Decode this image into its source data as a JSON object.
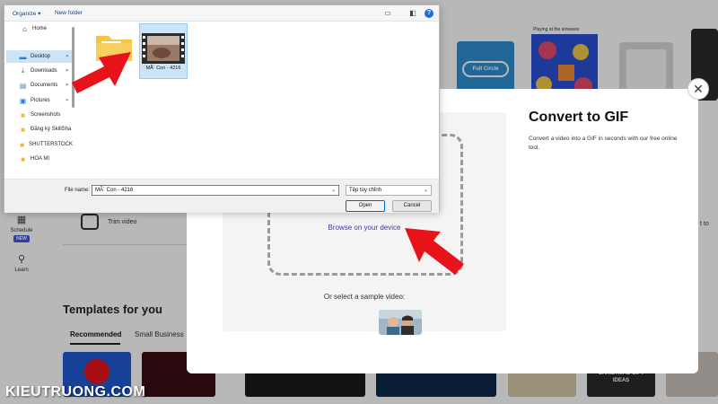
{
  "dialog": {
    "toolbar": {
      "organize_label": "Organize",
      "new_folder_label": "New folder"
    },
    "nav_items": [
      {
        "label": "Home",
        "icon": "home-icon"
      },
      {
        "label": "Desktop",
        "icon": "desktop-icon",
        "pinned": true,
        "selected": true
      },
      {
        "label": "Downloads",
        "icon": "download-icon",
        "pinned": true
      },
      {
        "label": "Documents",
        "icon": "document-icon",
        "pinned": true
      },
      {
        "label": "Pictures",
        "icon": "picture-icon",
        "pinned": true
      },
      {
        "label": "Screenshots",
        "icon": "folder-icon"
      },
      {
        "label": "Đăng ký SkillSha",
        "icon": "folder-icon"
      },
      {
        "label": "SHUTTERSTOCK",
        "icon": "folder-icon"
      },
      {
        "label": "HOA MI",
        "icon": "folder-icon"
      }
    ],
    "files": [
      {
        "name": "",
        "type": "folder"
      },
      {
        "name": "MÃ´ Con - 4216",
        "type": "video",
        "selected": true
      }
    ],
    "filename_label": "File name:",
    "filename_value": "MÃ´ Con - 4216",
    "filetype_value": "Tệp tùy chỉnh",
    "open_label": "Open",
    "cancel_label": "Cancel"
  },
  "modal": {
    "title": "Convert to GIF",
    "description": "Convert a video into a GIF in seconds with our free online tool.",
    "browse_link": "Browse on your device",
    "sample_label": "Or select a sample video:",
    "close_icon": "close-icon"
  },
  "background": {
    "sidebar": [
      {
        "label": "Schedule",
        "badge": "NEW",
        "icon": "calendar-icon"
      },
      {
        "label": "Learn",
        "icon": "lightbulb-icon"
      }
    ],
    "trim_label": "Trim video",
    "right_cut_label": "t to",
    "templates_title": "Templates for you",
    "tabs": [
      "Recommended",
      "Small Business"
    ],
    "card_text": {
      "full_circle": "Full Circle",
      "playing": "Playing at the airwaves",
      "christmas": "CHRISTMAS GIFT IDEAS"
    }
  },
  "watermark": "KIEUTRUONG.COM",
  "colors": {
    "accent_red": "#e8131a",
    "link_blue": "#3a3aa0",
    "selection_blue": "#cce4f7"
  }
}
